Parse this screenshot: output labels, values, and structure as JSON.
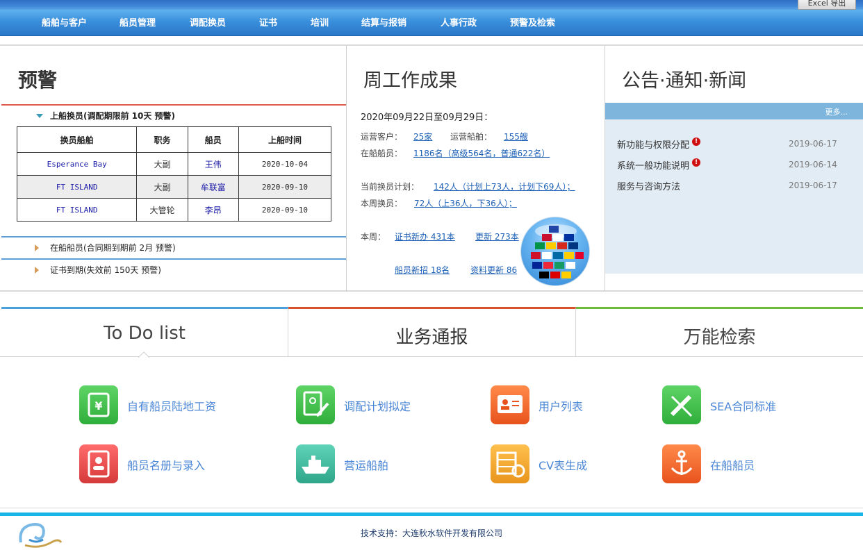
{
  "header": {
    "excel_button": "Excel 导出",
    "nav": [
      "船舶与客户",
      "船员管理",
      "调配换员",
      "证书",
      "培训",
      "结算与报销",
      "人事行政",
      "预警及检索"
    ]
  },
  "warning": {
    "title": "预警",
    "onboard_change": {
      "label": "上船换员(调配期限前 10天 预警)",
      "columns": [
        "换员船舶",
        "职务",
        "船员",
        "上船时间"
      ],
      "rows": [
        {
          "vessel": "Esperance Bay",
          "position": "大副",
          "crew": "王伟",
          "date": "2020-10-04"
        },
        {
          "vessel": "FT ISLAND",
          "position": "大副",
          "crew": "牟联富",
          "date": "2020-09-10"
        },
        {
          "vessel": "FT ISLAND",
          "position": "大管轮",
          "crew": "李昂",
          "date": "2020-09-10"
        }
      ]
    },
    "onboard_crew": "在船船员(合同期到期前 2月 预警)",
    "cert_expiry": "证书到期(失效前 150天 预警)"
  },
  "weekly": {
    "title": "周工作成果",
    "period": "2020年09月22日至09月29日：",
    "customers_label": "运营客户：",
    "customers_value": "25家",
    "vessels_label": "运营船舶：",
    "vessels_value": "155艘",
    "onboard_label": "在船船员：",
    "onboard_value": "1186名（高级564名，普通622名）",
    "plan_label": "当前换员计划：",
    "plan_value": "142人（计划上73人，计划下69人）；",
    "week_change_label": "本周换员：",
    "week_change_value": "72人（上36人，下36人）；",
    "this_week_label": "本周：",
    "cert_new": "证书新办 431本",
    "cert_update": "更新 273本",
    "crew_new": "船员新招 18名",
    "data_update": "资料更新 86"
  },
  "news": {
    "title": "公告·通知·新闻",
    "more": "更多...",
    "items": [
      {
        "title": "新功能与权限分配",
        "date": "2019-06-17",
        "alert": true
      },
      {
        "title": "系统一般功能说明",
        "date": "2019-06-14",
        "alert": true
      },
      {
        "title": "服务与咨询方法",
        "date": "2019-06-17",
        "alert": false
      }
    ]
  },
  "tabs": [
    "To Do list",
    "业务通报",
    "万能检索"
  ],
  "shortcuts": [
    {
      "label": "自有船员陆地工资",
      "icon": "wallet-icon",
      "color": "#3cc24a"
    },
    {
      "label": "调配计划拟定",
      "icon": "plan-edit-icon",
      "color": "#3cc24a"
    },
    {
      "label": "用户列表",
      "icon": "user-card-icon",
      "color": "#f06a2a"
    },
    {
      "label": "SEA合同标准",
      "icon": "pencil-ruler-icon",
      "color": "#3cc24a"
    },
    {
      "label": "船员名册与录入",
      "icon": "roster-book-icon",
      "color": "#e84545"
    },
    {
      "label": "营运船舶",
      "icon": "ship-icon",
      "color": "#3fb8a0"
    },
    {
      "label": "CV表生成",
      "icon": "cv-gear-icon",
      "color": "#f0a030"
    },
    {
      "label": "在船船员",
      "icon": "anchor-icon",
      "color": "#f06a2a"
    }
  ],
  "footer": {
    "support": "技术支持：大连秋水软件开发有限公司"
  }
}
